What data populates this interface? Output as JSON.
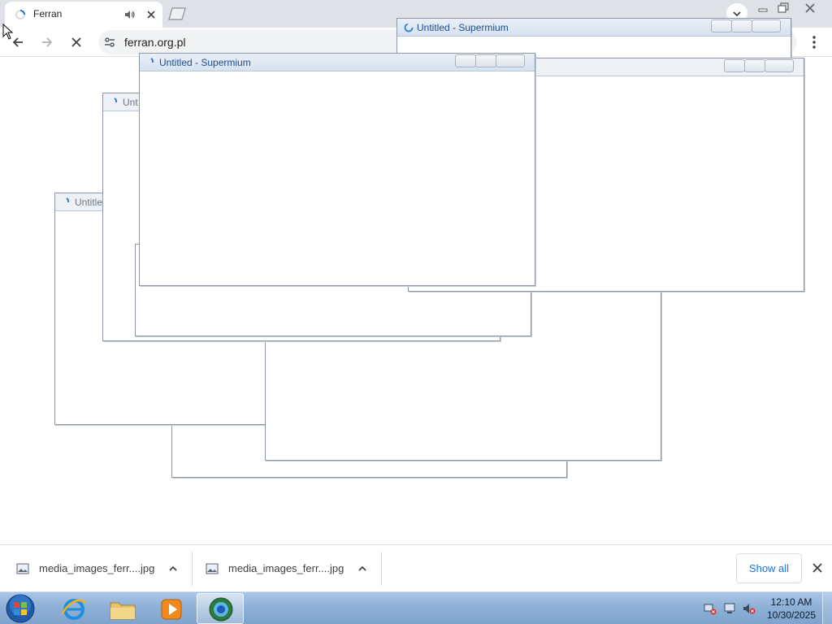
{
  "browser": {
    "tab": {
      "title": "Ferran"
    },
    "address_bar": {
      "url": "ferran.org.pl"
    }
  },
  "popups": [
    {
      "title": "Untitled - Supermium"
    },
    {
      "title": "Untitled - Supermium"
    },
    {
      "title": "Untitle"
    },
    {
      "title": "Unt"
    }
  ],
  "downloads": {
    "items": [
      {
        "filename": "media_images_ferr....jpg"
      },
      {
        "filename": "media_images_ferr....jpg"
      }
    ],
    "show_all_label": "Show all"
  },
  "taskbar": {
    "clock": {
      "time": "12:10 AM",
      "date": "10/30/2025"
    }
  },
  "icons": {
    "tab_favicon": "loading-spinner-icon",
    "audio": "speaker-icon",
    "tab_close": "close-icon",
    "new_tab": "new-tab-icon",
    "back": "back-arrow-icon",
    "forward": "forward-arrow-icon",
    "stop": "stop-icon",
    "site_settings": "tune-icon",
    "menu": "three-dot-menu-icon",
    "file": "image-file-icon",
    "chevron": "chevron-up-icon"
  },
  "colors": {
    "accent": "#1a73e8",
    "popup_title": "#1d4e8f",
    "taskbar": "#8fb1d7"
  }
}
